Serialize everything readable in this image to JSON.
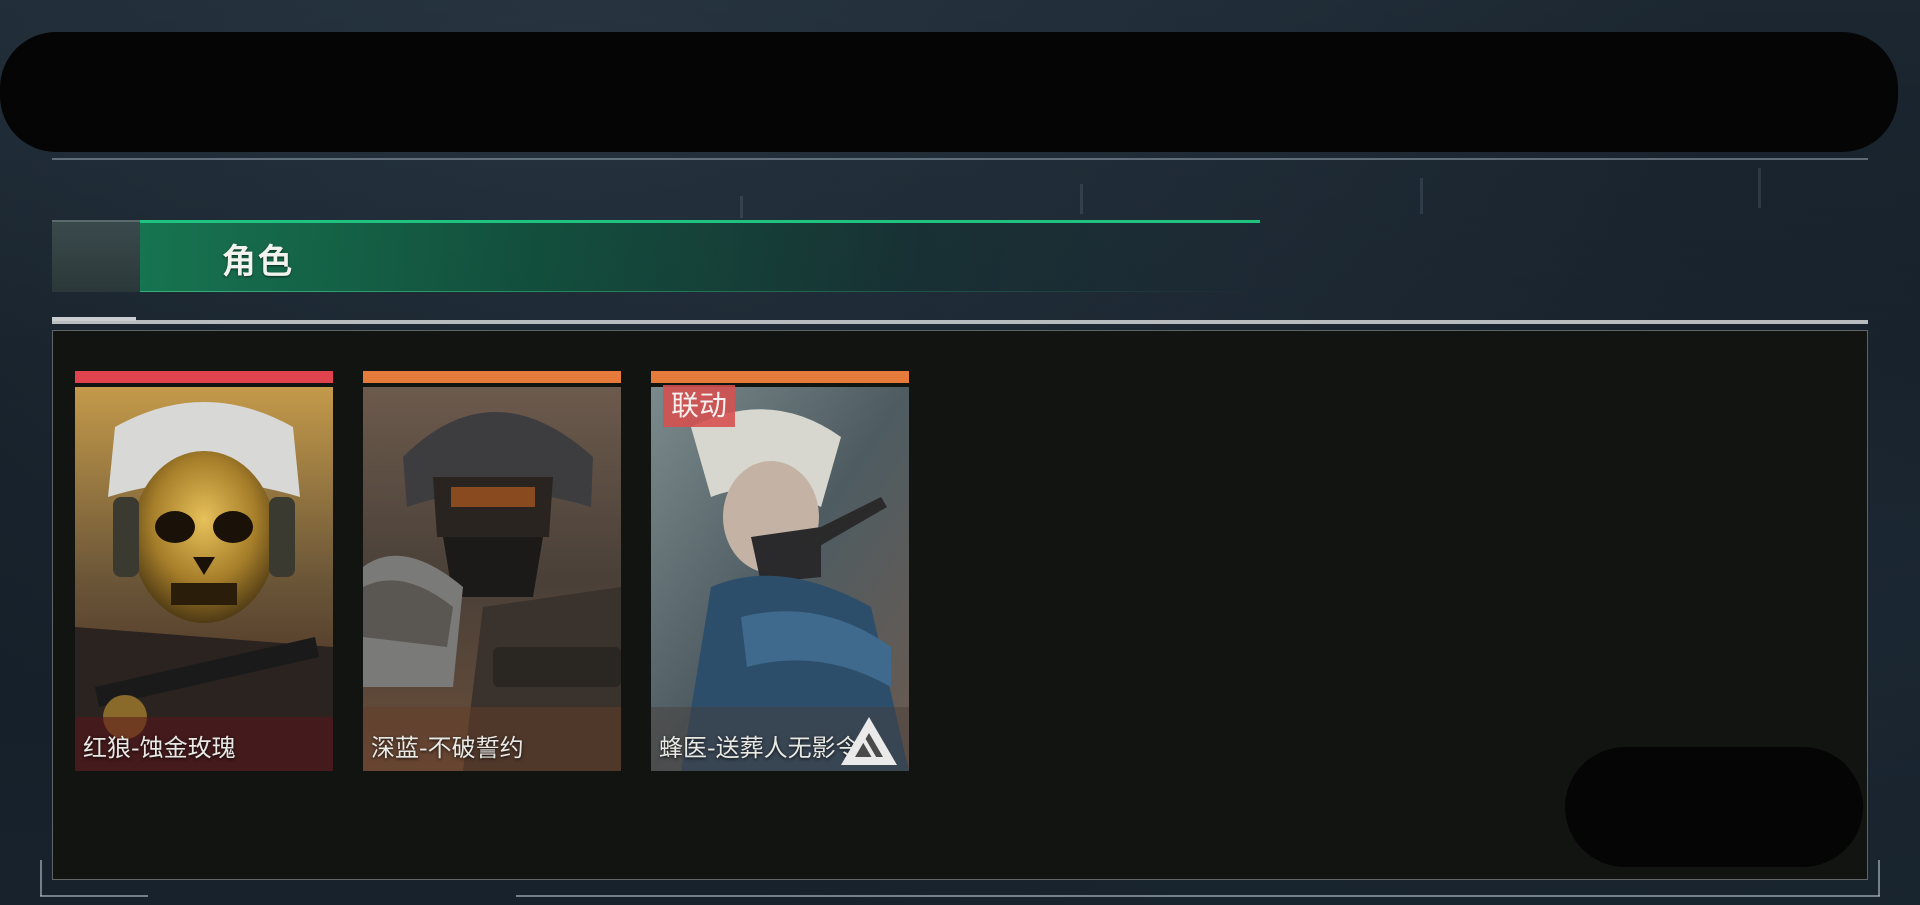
{
  "section": {
    "title": "角色"
  },
  "cards": [
    {
      "name": "红狼-蚀金玫瑰",
      "rarity_color": "#e0434e",
      "art_icon": "gold-skull-operator-portrait"
    },
    {
      "name": "深蓝-不破誓约",
      "rarity_color": "#e57a3a",
      "art_icon": "armored-helmet-operator-portrait"
    },
    {
      "name": "蜂医-送葬人无影令",
      "rarity_color": "#e57a3a",
      "badge": "联动",
      "art_icon": "white-haired-operator-portrait",
      "corner_icon": "collab-logo-icon"
    }
  ],
  "colors": {
    "accent": "#1fc27f",
    "panel_bg": "#121412",
    "page_bg": "#16202a"
  }
}
